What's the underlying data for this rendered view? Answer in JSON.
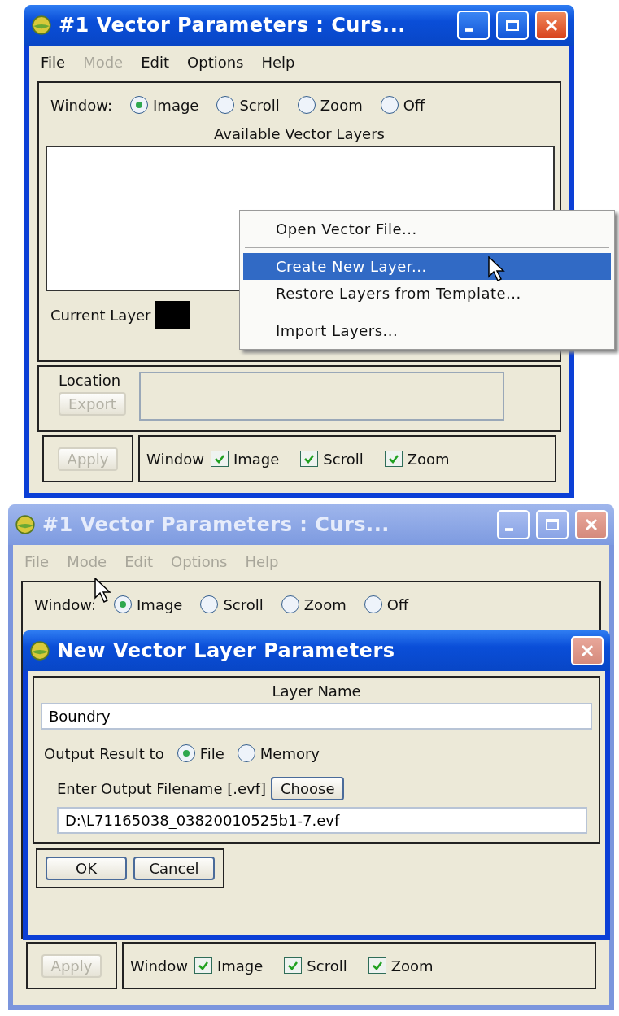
{
  "main_window": {
    "title": "#1 Vector Parameters : Curs...",
    "active": true,
    "menu": [
      {
        "label": "File",
        "disabled": false
      },
      {
        "label": "Mode",
        "disabled": true
      },
      {
        "label": "Edit",
        "disabled": false
      },
      {
        "label": "Options",
        "disabled": false
      },
      {
        "label": "Help",
        "disabled": false
      }
    ],
    "window_label": "Window:",
    "window_options": [
      {
        "label": "Image",
        "selected": true
      },
      {
        "label": "Scroll",
        "selected": false
      },
      {
        "label": "Zoom",
        "selected": false
      },
      {
        "label": "Off",
        "selected": false
      }
    ],
    "layers_title": "Available Vector Layers",
    "current_layer_label": "Current Layer",
    "location_label": "Location",
    "export_button": {
      "label": "Export",
      "disabled": true
    },
    "apply_button": {
      "label": "Apply",
      "disabled": true
    },
    "sync_label": "Window",
    "sync_options": [
      {
        "label": "Image",
        "checked": true
      },
      {
        "label": "Scroll",
        "checked": true
      },
      {
        "label": "Zoom",
        "checked": true
      }
    ]
  },
  "context_menu": {
    "items": [
      {
        "label": "Open Vector File...",
        "selected": false,
        "separator_after": true
      },
      {
        "label": "Create New Layer...",
        "selected": true,
        "separator_after": false
      },
      {
        "label": "Restore Layers from Template...",
        "selected": false,
        "separator_after": true
      },
      {
        "label": "Import Layers...",
        "selected": false,
        "separator_after": false
      }
    ]
  },
  "back_window": {
    "title": "#1 Vector Parameters : Curs...",
    "active": false,
    "menu": [
      {
        "label": "File",
        "disabled": true
      },
      {
        "label": "Mode",
        "disabled": true
      },
      {
        "label": "Edit",
        "disabled": true
      },
      {
        "label": "Options",
        "disabled": true
      },
      {
        "label": "Help",
        "disabled": true
      }
    ],
    "window_label": "Window:",
    "window_options": [
      {
        "label": "Image",
        "selected": true
      },
      {
        "label": "Scroll",
        "selected": false
      },
      {
        "label": "Zoom",
        "selected": false
      },
      {
        "label": "Off",
        "selected": false
      }
    ],
    "apply_button": {
      "label": "Apply",
      "disabled": true
    },
    "sync_label": "Window",
    "sync_options": [
      {
        "label": "Image",
        "checked": true
      },
      {
        "label": "Scroll",
        "checked": true
      },
      {
        "label": "Zoom",
        "checked": true
      }
    ]
  },
  "dialog": {
    "title": "New Vector Layer Parameters",
    "active": true,
    "layer_name_label": "Layer Name",
    "layer_name": "Boundry",
    "output_label": "Output Result to",
    "output_options": [
      {
        "label": "File",
        "selected": true
      },
      {
        "label": "Memory",
        "selected": false
      }
    ],
    "filename_label": "Enter Output Filename [.evf]",
    "choose_button": "Choose",
    "filename": "D:\\L71165038_03820010525b1-7.evf",
    "buttons": [
      "OK",
      "Cancel"
    ]
  }
}
